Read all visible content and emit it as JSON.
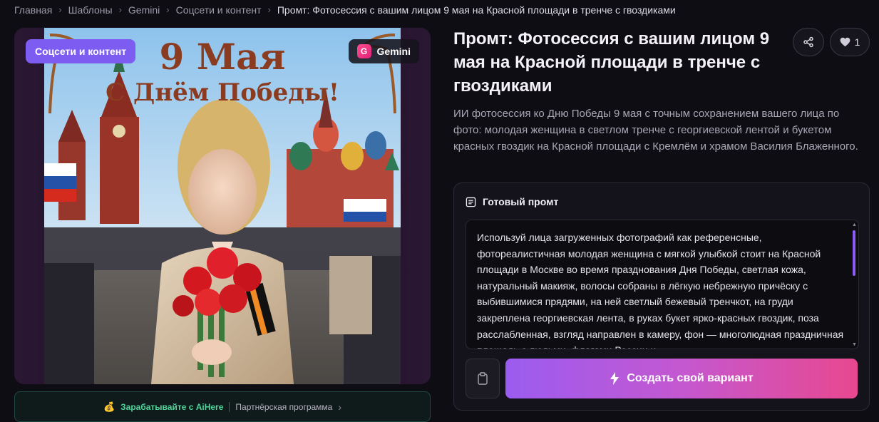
{
  "breadcrumb": {
    "items": [
      "Главная",
      "Шаблоны",
      "Gemini",
      "Соцсети и контент"
    ],
    "current": "Промт: Фотосессия с вашим лицом 9 мая на Красной площади в тренче с гвоздиками"
  },
  "image_card": {
    "category_chip": "Соцсети и контент",
    "model_chip": "Gemini",
    "model_badge_letter": "G",
    "poster_line1": "9 Мая",
    "poster_line2": "С Днём Победы!"
  },
  "affiliate": {
    "icon": "money-bag-icon",
    "earn_label": "Зарабатывайте с AiHere",
    "partner_label": "Партнёрская программа"
  },
  "page": {
    "title": "Промт: Фотосессия с вашим лицом 9 мая на Красной площади в тренче с гвоздиками",
    "like_count": "1",
    "description": "ИИ фотосессия ко Дню Победы 9 мая с точным сохранением вашего лица по фото: молодая женщина в светлом тренче с георгиевской лентой и букетом красных гвоздик на Красной площади с Кремлём и храмом Василия Блаженного."
  },
  "prompt": {
    "header": "Готовый промт",
    "text": "Используй лица загруженных фотографий как референсные, фотореалистичная молодая женщина с мягкой улыбкой стоит на Красной площади в Москве во время празднования Дня Победы, светлая кожа, натуральный макияж, волосы собраны в лёгкую небрежную причёску с выбившимися прядями, на ней светлый бежевый тренчкот, на груди закреплена георгиевская лента, в руках букет ярко-красных гвоздик, поза расслабленная, взгляд направлен в камеру, фон — многолюдная праздничная площадь с людьми, флагами России и",
    "create_button": "Создать свой вариант"
  },
  "colors": {
    "accent": "#7d5cf2",
    "button_gradient_start": "#9b5cf0",
    "button_gradient_end": "#e8488f",
    "affiliate_green": "#4fd69c"
  }
}
